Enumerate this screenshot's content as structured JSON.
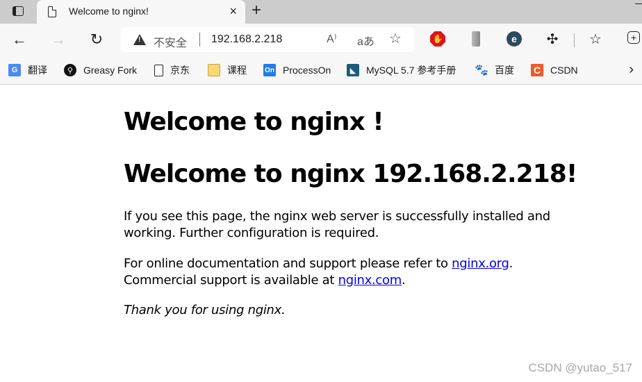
{
  "browser": {
    "tab": {
      "title": "Welcome to nginx!",
      "close": "×"
    },
    "new_tab": "+",
    "nav": {
      "back": "←",
      "forward": "→",
      "reload": "↻"
    },
    "address": {
      "security_label": "不安全",
      "url": "192.168.2.218",
      "read_aloud": "A⁾",
      "translate": "aあ",
      "add_favorite": "☆"
    },
    "extensions": [
      {
        "name": "adblock-stop",
        "glyph": "✋"
      },
      {
        "name": "office",
        "glyph": ""
      },
      {
        "name": "e-extension",
        "glyph": "e"
      },
      {
        "name": "extensions-puzzle",
        "glyph": "✣"
      },
      {
        "name": "favorites",
        "glyph": "☆"
      },
      {
        "name": "collections",
        "glyph": "+"
      }
    ],
    "bookmarks": [
      {
        "label": "翻译",
        "icon": "translate-icon",
        "glyph": "G"
      },
      {
        "label": "Greasy Fork",
        "icon": "greasy-fork-icon",
        "glyph": "⚲"
      },
      {
        "label": "京东",
        "icon": "page-icon",
        "glyph": ""
      },
      {
        "label": "课程",
        "icon": "folder-icon",
        "glyph": ""
      },
      {
        "label": "ProcessOn",
        "icon": "processon-icon",
        "glyph": "On"
      },
      {
        "label": "MySQL 5.7 参考手册",
        "icon": "mysql-icon",
        "glyph": "◣"
      },
      {
        "label": "百度",
        "icon": "baidu-icon",
        "glyph": "🐾"
      },
      {
        "label": "CSDN",
        "icon": "csdn-icon",
        "glyph": "C"
      }
    ],
    "bookmarks_more": "›"
  },
  "page": {
    "heading1": "Welcome to nginx !",
    "heading2": "Welcome to nginx 192.168.2.218!",
    "para1_line1": "If you see this page, the nginx web server is successfully installed and",
    "para1_line2": "working. Further configuration is required.",
    "para2_prefix": "For online documentation and support please refer to ",
    "para2_link1": "nginx.org",
    "para2_mid": ".",
    "para2_line2_prefix": "Commercial support is available at ",
    "para2_link2": "nginx.com",
    "para2_end": ".",
    "para3": "Thank you for using nginx."
  },
  "watermark": "CSDN @yutao_517",
  "colors": {
    "link": "#0000ee",
    "tabstrip": "#cccccc",
    "toolbar": "#f7f7f7",
    "adblock": "#e0141b",
    "csdn": "#f05a28",
    "processon": "#1f7cea"
  }
}
